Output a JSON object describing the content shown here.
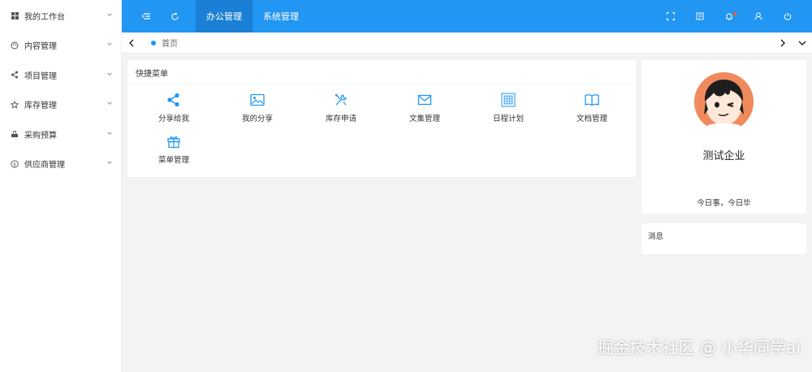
{
  "sidebar": {
    "items": [
      {
        "label": "我的工作台",
        "icon": "windows-icon"
      },
      {
        "label": "内容管理",
        "icon": "palette-icon"
      },
      {
        "label": "项目管理",
        "icon": "share-icon"
      },
      {
        "label": "库存管理",
        "icon": "star-icon"
      },
      {
        "label": "采购预算",
        "icon": "cart-icon"
      },
      {
        "label": "供应商管理",
        "icon": "dollar-icon"
      }
    ]
  },
  "header": {
    "tabs": [
      {
        "label": "办公管理",
        "active": true
      },
      {
        "label": "系统管理",
        "active": false
      }
    ],
    "accent": "#2196f3"
  },
  "tabbar": {
    "page_tab": "首页"
  },
  "quick_menu": {
    "title": "快捷菜单",
    "items": [
      {
        "label": "分享给我",
        "icon": "share-icon"
      },
      {
        "label": "我的分享",
        "icon": "image-icon"
      },
      {
        "label": "库存申请",
        "icon": "tools-icon"
      },
      {
        "label": "文集管理",
        "icon": "mail-icon"
      },
      {
        "label": "日程计划",
        "icon": "grid-dots-icon"
      },
      {
        "label": "文档管理",
        "icon": "book-icon"
      },
      {
        "label": "菜单管理",
        "icon": "gift-icon"
      }
    ]
  },
  "profile": {
    "company": "测试企业",
    "motto": "今日事，今日毕"
  },
  "messages": {
    "title": "消息"
  },
  "watermark": "掘金技术社区 @ 小华同学ai"
}
